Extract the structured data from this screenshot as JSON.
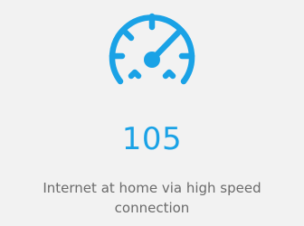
{
  "stat": {
    "icon": "speedometer-icon",
    "value": "105",
    "caption": "Internet at home via high speed connection"
  },
  "colors": {
    "background": "#f2f2f2",
    "accent": "#1aa2e6",
    "caption": "#6b6b6b"
  }
}
